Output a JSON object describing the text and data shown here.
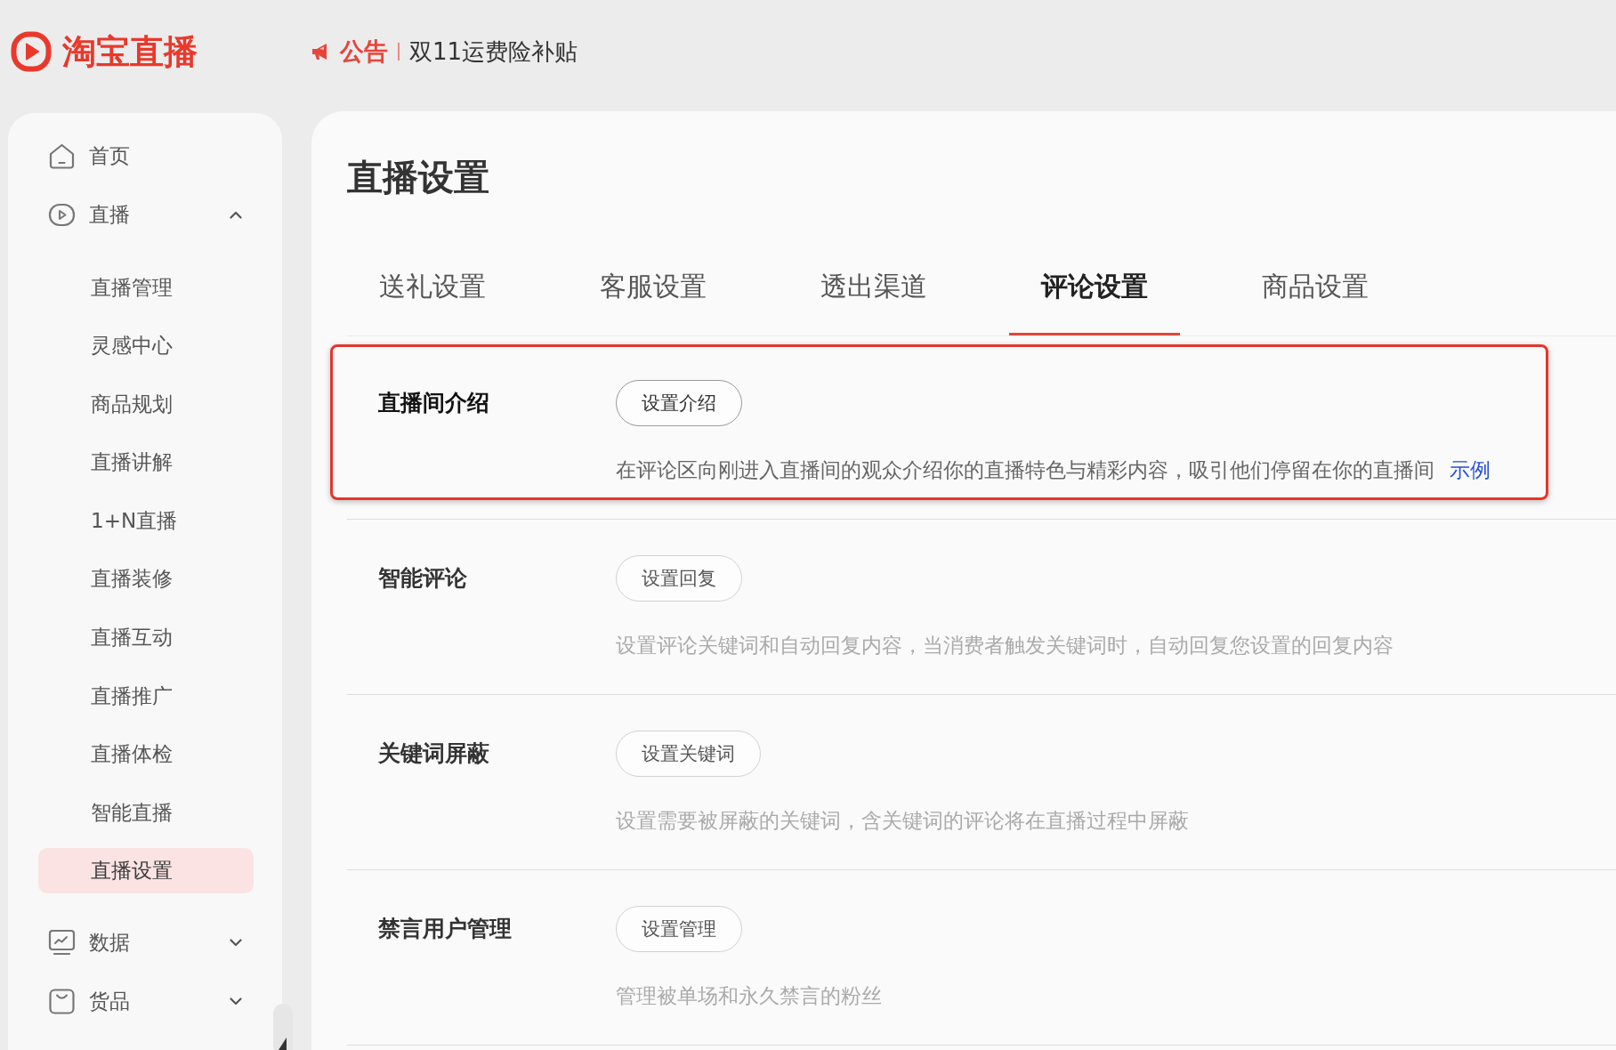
{
  "header": {
    "logo_text": "淘宝直播",
    "notice": {
      "tag": "公告",
      "text": "双11运费险补贴"
    }
  },
  "sidebar": {
    "items": [
      {
        "label": "首页",
        "kind": "link",
        "selected": false
      },
      {
        "label": "直播",
        "kind": "group",
        "selected": false,
        "expanded": true,
        "children": [
          {
            "label": "直播管理",
            "selected": false
          },
          {
            "label": "灵感中心",
            "selected": false
          },
          {
            "label": "商品规划",
            "selected": false
          },
          {
            "label": "直播讲解",
            "selected": false
          },
          {
            "label": "1+N直播",
            "selected": false
          },
          {
            "label": "直播装修",
            "selected": false
          },
          {
            "label": "直播互动",
            "selected": false
          },
          {
            "label": "直播推广",
            "selected": false
          },
          {
            "label": "直播体检",
            "selected": false
          },
          {
            "label": "智能直播",
            "selected": false
          },
          {
            "label": "直播设置",
            "selected": true
          }
        ]
      },
      {
        "label": "数据",
        "kind": "group",
        "selected": false,
        "expanded": false
      },
      {
        "label": "货品",
        "kind": "group",
        "selected": false,
        "expanded": false
      }
    ]
  },
  "page": {
    "title": "直播设置",
    "tabs": [
      {
        "label": "送礼设置",
        "selected": false
      },
      {
        "label": "客服设置",
        "selected": false
      },
      {
        "label": "透出渠道",
        "selected": false
      },
      {
        "label": "评论设置",
        "selected": true
      },
      {
        "label": "商品设置",
        "selected": false
      }
    ],
    "rows": [
      {
        "label": "直播间介绍",
        "button": "设置介绍",
        "description": "在评论区向刚进入直播间的观众介绍你的直播特色与精彩内容，吸引他们停留在你的直播间",
        "link": "示例",
        "highlighted": true
      },
      {
        "label": "智能评论",
        "button": "设置回复",
        "description": "设置评论关键词和自动回复内容，当消费者触发关键词时，自动回复您设置的回复内容",
        "highlighted": false
      },
      {
        "label": "关键词屏蔽",
        "button": "设置关键词",
        "description": "设置需要被屏蔽的关键词，含关键词的评论将在直播过程中屏蔽",
        "highlighted": false
      },
      {
        "label": "禁言用户管理",
        "button": "设置管理",
        "description": "管理被单场和永久禁言的粉丝",
        "highlighted": false
      }
    ]
  }
}
